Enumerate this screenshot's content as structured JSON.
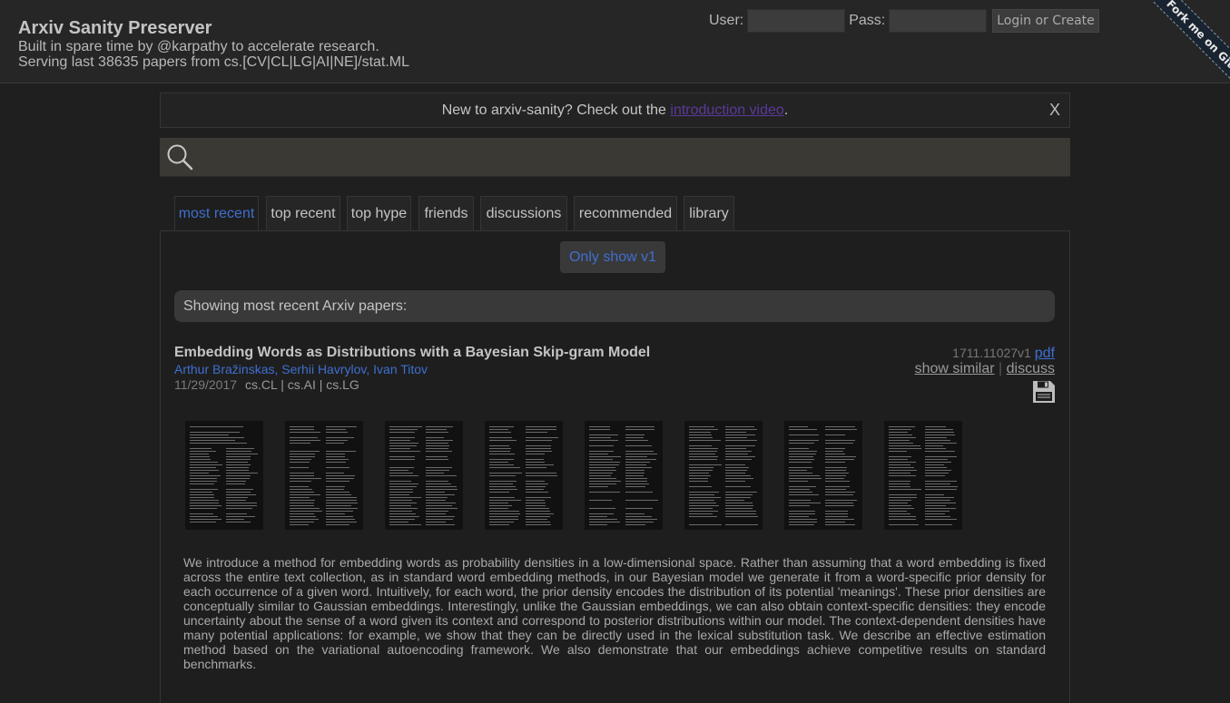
{
  "header": {
    "title": "Arxiv Sanity Preserver",
    "tagline1": "Built in spare time by @karpathy to accelerate research.",
    "tagline2": "Serving last 38635 papers from cs.[CV|CL|LG|AI|NE]/stat.ML",
    "user_label": "User:",
    "pass_label": "Pass:",
    "login_button": "Login or Create",
    "ribbon": "Fork me on GitHub"
  },
  "intro": {
    "text_before": "New to arxiv-sanity? Check out the ",
    "link": "introduction video",
    "text_after": ".",
    "close": "X"
  },
  "search": {
    "value": ""
  },
  "tabs": [
    {
      "label": "most recent",
      "active": true
    },
    {
      "label": "top recent"
    },
    {
      "label": "top hype"
    },
    {
      "label": "friends"
    },
    {
      "label": "discussions"
    },
    {
      "label": "recommended"
    },
    {
      "label": "library"
    }
  ],
  "only_v1": "Only show v1",
  "showing": "Showing most recent Arxiv papers:",
  "paper": {
    "title": "Embedding Words as Distributions with a Bayesian Skip-gram Model",
    "authors": "Arthur Bražinskas, Serhii Havrylov, Ivan Titov",
    "date": "11/29/2017",
    "categories": "cs.CL | cs.AI | cs.LG",
    "id": "1711.11027v1",
    "pdf": "pdf",
    "show_similar": "show similar",
    "separator": "|",
    "discuss": "discuss",
    "thumbnail_count": 8,
    "abstract": "We introduce a method for embedding words as probability densities in a low-dimensional space. Rather than assuming that a word embedding is fixed across the entire text collection, as in standard word embedding methods, in our Bayesian model we generate it from a word-specific prior density for each occurrence of a given word. Intuitively, for each word, the prior density encodes the distribution of its potential 'meanings'. These prior densities are conceptually similar to Gaussian embeddings. Interestingly, unlike the Gaussian embeddings, we can also obtain context-specific densities: they encode uncertainty about the sense of a word given its context and correspond to posterior distributions within our model. The context-dependent densities have many potential applications: for example, we show that they can be directly used in the lexical substitution task. We describe an effective estimation method based on the variational autoencoding framework. We also demonstrate that our embeddings achieve competitive results on standard benchmarks."
  },
  "colors": {
    "accent": "#3f6fcf",
    "link_visited": "#5a3a9a",
    "background": "#1f1f1f"
  }
}
